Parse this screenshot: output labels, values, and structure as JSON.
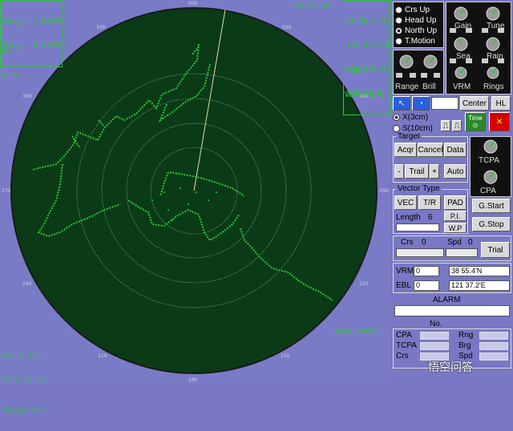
{
  "radar": {
    "top_left": [
      "Range  1.00NM",
      "Rings  0.25NM"
    ],
    "mode_lines": [
      "RM",
      "N Up"
    ],
    "time": "03:42:06",
    "position_box": [
      "38 55.4'N",
      "121 37.2'E",
      "HDG 010.0",
      "SOG 11.0"
    ],
    "trail": "TRUE",
    "vectors": "VECTORS 6",
    "cpa": "CPA 0.500",
    "tcpa": "TCPA 12.00",
    "trails_off": "TRAILS OFF",
    "para_index": "PARA INDEX",
    "bearings": {
      "b0": "000",
      "b30": "030",
      "b60": "060",
      "b90": "090",
      "b120": "120",
      "b150": "150",
      "b180": "180",
      "b210": "210",
      "b240": "240",
      "b270": "270",
      "b300": "300",
      "b330": "330"
    },
    "colors": {
      "scope": "#0b3a17",
      "echo": "#2cc93a",
      "bg": "#7a7bc6"
    }
  },
  "panel": {
    "modes": [
      {
        "label": "Crs Up",
        "checked": false
      },
      {
        "label": "Head Up",
        "checked": false
      },
      {
        "label": "North Up",
        "checked": true
      },
      {
        "label": "T.Motion",
        "checked": false
      }
    ],
    "knobs": {
      "gain": "Gain",
      "tune": "Tune",
      "sea": "Sea",
      "rain": "Rain",
      "range": "Range",
      "brill": "Brill",
      "vrm": "VRM",
      "rings": "Rings",
      "tcpa": "TCPA",
      "cpa": "CPA"
    },
    "center": "Center",
    "hl": "HL",
    "band_x": "X(3cm)",
    "band_s": "S(10cm)",
    "time_label": "Time",
    "target_title": "Target",
    "acqr": "Acqr",
    "cancel": "Cancel",
    "data": "Data",
    "minus": "-",
    "trail": "Trail",
    "plus": "+",
    "auto": "Auto",
    "vector_title": "Vector Type",
    "vec": "VEC",
    "tr": "T/R",
    "pad": "PAD",
    "pi": "P.I.",
    "wp": "W.P",
    "length_label": "Length",
    "length_value": "6",
    "gstart": "G.Start",
    "gstop": "G.Stop",
    "crs_label": "Crs",
    "crs_value": "0",
    "spd_label": "Spd",
    "spd_value": "0",
    "trial": "Trial",
    "vrm_label": "VRM",
    "vrm_value": "0",
    "ebl_label": "EBL",
    "ebl_value": "0",
    "lat": "38 55.4'N",
    "lon": "121 37.2'E",
    "alarm": "ALARM",
    "no_label": "No.",
    "cpa_label": "CPA",
    "tcpa_label": "TCPA",
    "crs2_label": "Crs",
    "rng_label": "Rng",
    "brg_label": "Brg",
    "spd2_label": "Spd"
  },
  "watermark": "悟空问答"
}
